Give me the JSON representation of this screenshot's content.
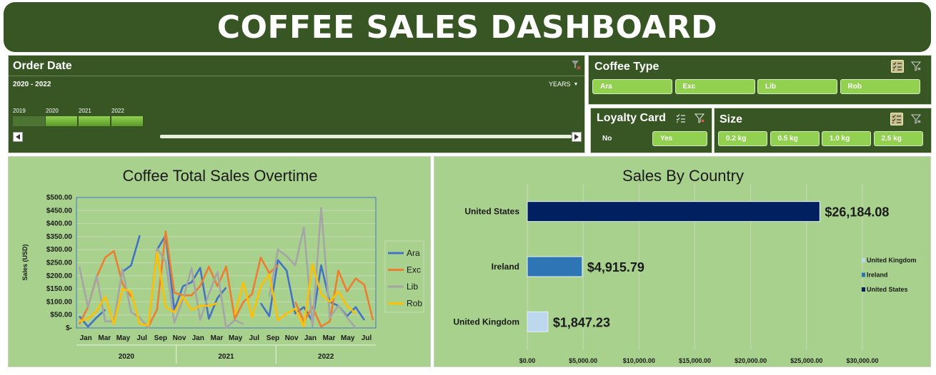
{
  "header": {
    "title": "COFFEE SALES DASHBOARD"
  },
  "order_date": {
    "title": "Order Date",
    "range_label": "2020 - 2022",
    "level_label": "YEARS",
    "years": [
      "2019",
      "2020",
      "2021",
      "2022"
    ],
    "selected_years": [
      "2020",
      "2021",
      "2022"
    ]
  },
  "coffee_type": {
    "title": "Coffee Type",
    "items": [
      "Ara",
      "Exc",
      "Lib",
      "Rob"
    ]
  },
  "loyalty_card": {
    "title": "Loyalty Card",
    "items": [
      "No",
      "Yes"
    ],
    "selected": [
      "Yes"
    ]
  },
  "size": {
    "title": "Size",
    "items": [
      "0.2 kg",
      "0.5 kg",
      "1.0 kg",
      "2.5 kg"
    ]
  },
  "colors": {
    "dark_green": "#375623",
    "light_green": "#a9d18e",
    "pill": "#92d050",
    "ara": "#4472c4",
    "exc": "#ed7d31",
    "lib": "#a5a5a5",
    "rob": "#ffc000",
    "us": "#002060",
    "ireland": "#2e75b6",
    "uk": "#bdd7ee"
  },
  "chart_data": [
    {
      "type": "line",
      "title": "Coffee Total Sales Overtime",
      "ylabel": "Sales (USD)",
      "ylim": [
        0,
        500
      ],
      "yticks": [
        "$-",
        "$50.00",
        "$100.00",
        "$150.00",
        "$200.00",
        "$250.00",
        "$300.00",
        "$350.00",
        "$400.00",
        "$450.00",
        "$500.00"
      ],
      "month_labels": [
        "Jan",
        "Mar",
        "May",
        "Jul",
        "Sep",
        "Nov",
        "Jan",
        "Mar",
        "May",
        "Jul",
        "Sep",
        "Nov",
        "Jan",
        "Mar",
        "May",
        "Jul"
      ],
      "year_labels": [
        "2020",
        "2021",
        "2022"
      ],
      "legend_position": "right",
      "series": [
        {
          "name": "Ara",
          "values": [
            45,
            5,
            40,
            70,
            null,
            215,
            240,
            355,
            null,
            300,
            355,
            70,
            160,
            175,
            230,
            35,
            115,
            155,
            null,
            null,
            null,
            95,
            45,
            260,
            220,
            55,
            80,
            25,
            240,
            100,
            85,
            45,
            80,
            30
          ]
        },
        {
          "name": "Exc",
          "values": [
            15,
            80,
            195,
            270,
            295,
            170,
            120,
            null,
            5,
            70,
            370,
            135,
            125,
            125,
            160,
            235,
            160,
            235,
            35,
            100,
            130,
            270,
            210,
            240,
            null,
            100,
            25,
            80,
            5,
            25,
            220,
            140,
            190,
            165,
            30
          ]
        },
        {
          "name": "Lib",
          "values": [
            235,
            80,
            200,
            25,
            25,
            225,
            60,
            40,
            0,
            305,
            255,
            20,
            110,
            230,
            30,
            130,
            215,
            0,
            30,
            15,
            null,
            null,
            120,
            300,
            275,
            240,
            385,
            5,
            460,
            40,
            85,
            40,
            0
          ]
        },
        {
          "name": "Rob",
          "values": [
            25,
            35,
            65,
            120,
            15,
            150,
            140,
            15,
            10,
            290,
            80,
            60,
            120,
            70,
            85,
            85,
            95,
            null,
            50,
            175,
            40,
            160,
            205,
            30,
            55,
            75,
            5,
            245,
            130,
            100,
            140,
            85,
            55
          ]
        }
      ]
    },
    {
      "type": "bar",
      "orientation": "horizontal",
      "title": "Sales By Country",
      "categories": [
        "United States",
        "Ireland",
        "United Kingdom"
      ],
      "values": [
        26184.08,
        4915.79,
        1847.23
      ],
      "value_labels": [
        "$26,184.08",
        "$4,915.79",
        "$1,847.23"
      ],
      "xlim": [
        0,
        30000
      ],
      "xticks": [
        "$0.00",
        "$5,000.00",
        "$10,000.00",
        "$15,000.00",
        "$20,000.00",
        "$25,000.00",
        "$30,000.00"
      ],
      "legend": [
        "United Kingdom",
        "Ireland",
        "United States"
      ],
      "legend_position": "right",
      "grid": true
    }
  ]
}
